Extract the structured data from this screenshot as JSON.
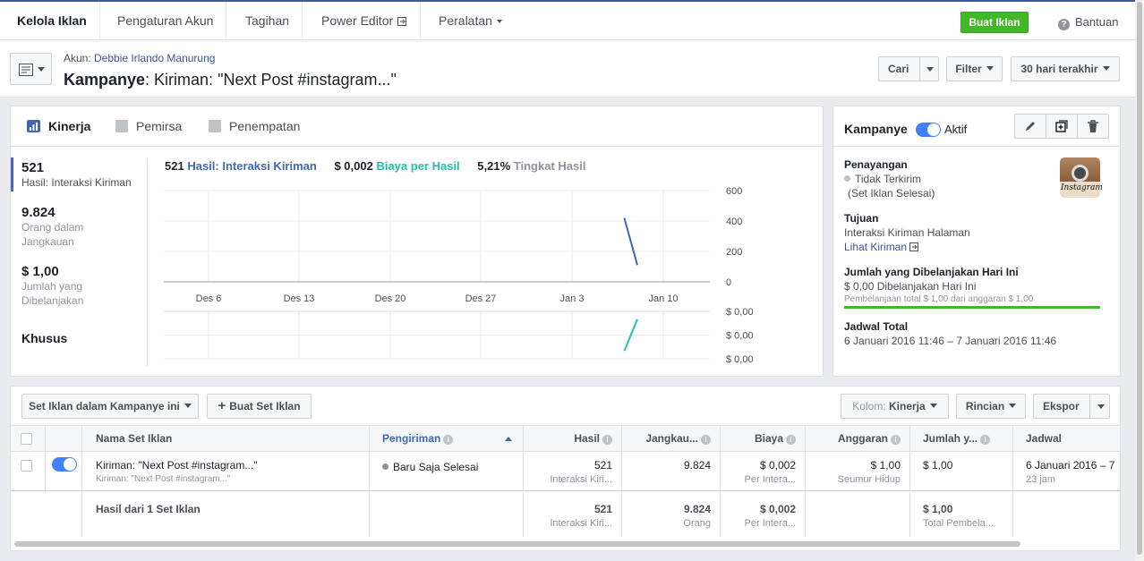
{
  "nav": {
    "items": [
      "Kelola Iklan",
      "Pengaturan Akun",
      "Tagihan",
      "Power Editor",
      "Peralatan"
    ],
    "create_ad": "Buat Iklan",
    "help": "Bantuan"
  },
  "header": {
    "account_prefix": "Akun:",
    "account_name": "Debbie Irlando Manurung",
    "title_bold": "Kampanye",
    "title_rest": ": Kiriman: \"Next Post #instagram...\"",
    "search": "Cari",
    "filter": "Filter",
    "date_range": "30 hari terakhir"
  },
  "performance": {
    "tabs": [
      "Kinerja",
      "Pemirsa",
      "Penempatan"
    ],
    "metrics": [
      {
        "value": "521",
        "label": "Hasil: Interaksi Kiriman"
      },
      {
        "value": "9.824",
        "label": "Orang dalam Jangkauan"
      },
      {
        "value": "$ 1,00",
        "label": "Jumlah yang Dibelanjakan"
      }
    ],
    "custom": "Khusus",
    "legend": [
      {
        "value": "521",
        "label": "Hasil: Interaksi Kiriman",
        "color": "#4267b2"
      },
      {
        "value": "$ 0,002",
        "label": "Biaya per Hasil",
        "color": "#20c0a8"
      },
      {
        "value": "5,21%",
        "label": "Tingkat Hasil",
        "color": "#90949c"
      }
    ]
  },
  "chart_data": {
    "type": "line",
    "x_ticks": [
      "Des 6",
      "Des 13",
      "Des 20",
      "Des 27",
      "Jan 3",
      "Jan 10"
    ],
    "y_ticks_top": [
      "600",
      "400",
      "200",
      "0"
    ],
    "y_ticks_bottom": [
      "$ 0,00",
      "$ 0,00",
      "$ 0,00"
    ],
    "ylim_top": [
      0,
      600
    ],
    "series": [
      {
        "name": "Hasil: Interaksi Kiriman",
        "color": "#4267b2",
        "points": [
          [
            "Jan 7",
            420
          ],
          [
            "Jan 8",
            110
          ]
        ]
      },
      {
        "name": "Biaya per Hasil",
        "color": "#20c0a8",
        "points": [
          [
            "Jan 7",
            0.0005
          ],
          [
            "Jan 8",
            0.0025
          ]
        ]
      }
    ]
  },
  "campaign": {
    "title": "Kampanye",
    "status": "Aktif",
    "delivery_title": "Penayangan",
    "delivery_status": "Tidak Terkirim",
    "delivery_note": "(Set Iklan Selesai)",
    "objective_title": "Tujuan",
    "objective": "Interaksi Kiriman Halaman",
    "view_post": "Lihat Kiriman",
    "spent_title": "Jumlah yang Dibelanjakan Hari Ini",
    "spent_value": "$ 0,00 Dibelanjakan Hari Ini",
    "spent_total": "Pembelanjaan total $ 1,00 dari anggaran $ 1,00",
    "spent_fraction": 1.0,
    "schedule_title": "Jadwal Total",
    "schedule": "6 Januari 2016 11:46 – 7 Januari 2016 11:46",
    "logo_text": "Instagram"
  },
  "adsets": {
    "dropdown": "Set Iklan dalam Kampanye ini",
    "create": "Buat Set Iklan",
    "columns_prefix": "Kolom:",
    "columns_value": "Kinerja",
    "breakdown": "Rincian",
    "export": "Ekspor",
    "headers": [
      "Nama Set Iklan",
      "Pengiriman",
      "Hasil",
      "Jangkau...",
      "Biaya",
      "Anggaran",
      "Jumlah y...",
      "Jadwal"
    ],
    "row": {
      "name": "Kiriman: \"Next Post #instagram...\"",
      "sub": "Kiriman: \"Next Post #instagram...\"",
      "delivery": "Baru Saja Selesai",
      "results": "521",
      "results_sub": "Interaksi Kiri...",
      "reach": "9.824",
      "cost": "$ 0,002",
      "cost_sub": "Per Intera...",
      "budget": "$ 1,00",
      "budget_sub": "Seumur Hidup",
      "spent": "$ 1,00",
      "schedule": "6 Januari 2016 – 7",
      "schedule_sub": "23 jam"
    },
    "total": {
      "label": "Hasil dari 1 Set Iklan",
      "results": "521",
      "results_sub": "Interaksi Kiri...",
      "reach": "9.824",
      "reach_sub": "Orang",
      "cost": "$ 0,002",
      "cost_sub": "Per Intera...",
      "spent": "$ 1,00",
      "spent_sub": "Total Pembela..."
    }
  }
}
